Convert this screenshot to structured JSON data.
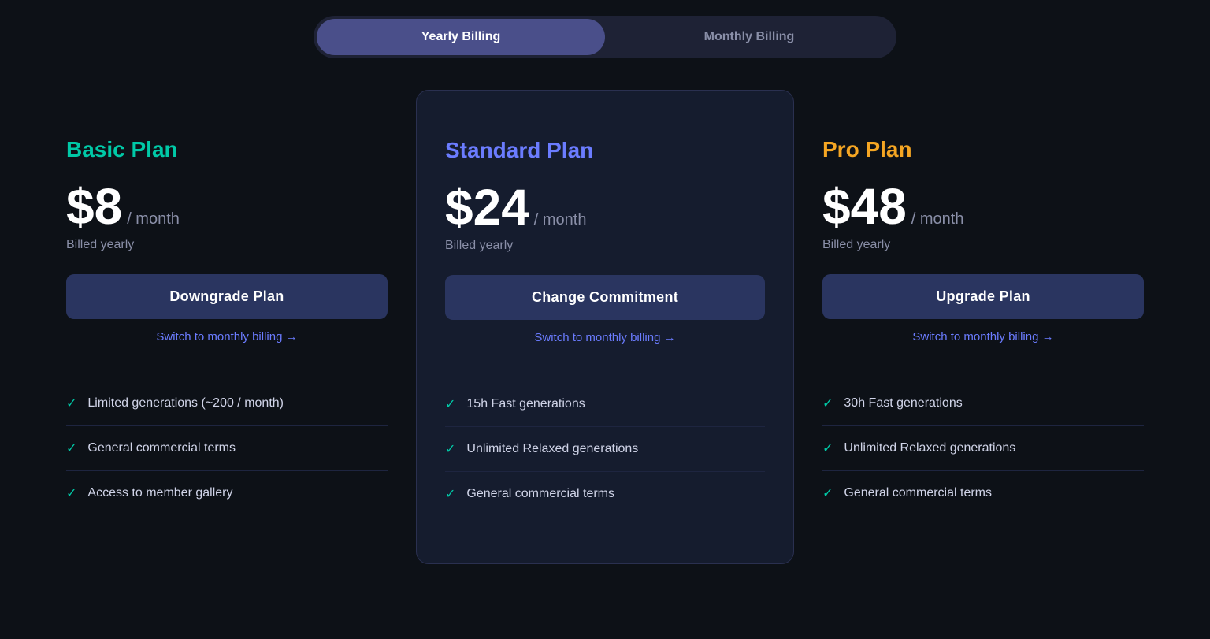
{
  "billing_toggle": {
    "yearly_label": "Yearly Billing",
    "monthly_label": "Monthly Billing",
    "active": "yearly"
  },
  "plans": [
    {
      "id": "basic",
      "name": "Basic Plan",
      "name_class": "basic",
      "price": "$8",
      "period": "/ month",
      "billed": "Billed yearly",
      "button_label": "Downgrade Plan",
      "switch_label": "Switch to monthly billing →",
      "highlighted": false,
      "features": [
        "Limited generations (~200 / month)",
        "General commercial terms",
        "Access to member gallery"
      ]
    },
    {
      "id": "standard",
      "name": "Standard Plan",
      "name_class": "standard",
      "price": "$24",
      "period": "/ month",
      "billed": "Billed yearly",
      "button_label": "Change Commitment",
      "switch_label": "Switch to monthly billing →",
      "highlighted": true,
      "features": [
        "15h Fast generations",
        "Unlimited Relaxed generations",
        "General commercial terms"
      ]
    },
    {
      "id": "pro",
      "name": "Pro Plan",
      "name_class": "pro",
      "price": "$48",
      "period": "/ month",
      "billed": "Billed yearly",
      "button_label": "Upgrade Plan",
      "switch_label": "Switch to monthly billing →",
      "highlighted": false,
      "features": [
        "30h Fast generations",
        "Unlimited Relaxed generations",
        "General commercial terms"
      ]
    }
  ]
}
